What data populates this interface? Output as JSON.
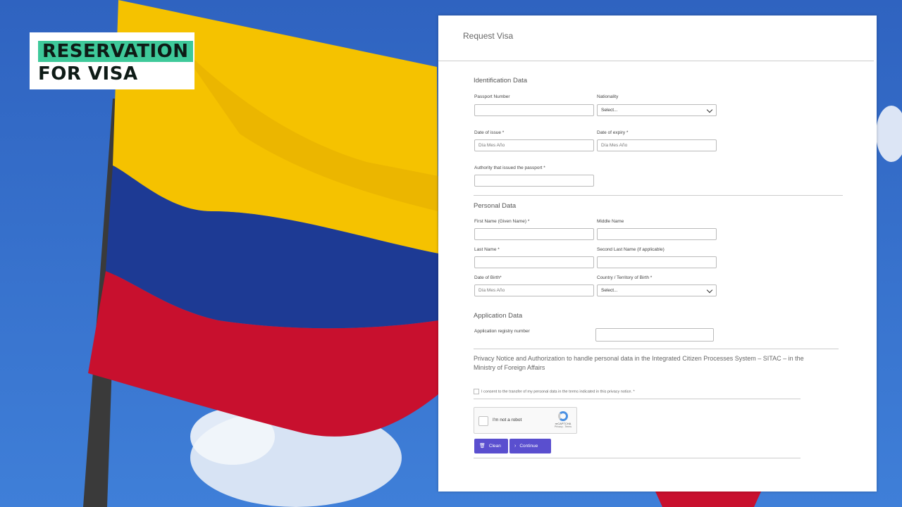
{
  "logo": {
    "line1": "RESERVATION",
    "line2": "FOR VISA"
  },
  "form": {
    "title": "Request Visa",
    "identification": {
      "heading": "Identification Data",
      "passport_number": {
        "label": "Passport Number",
        "value": ""
      },
      "nationality": {
        "label": "Nationality",
        "value": "Select..."
      },
      "date_of_issue": {
        "label": "Date of issue *",
        "placeholder": "Día Mes Año"
      },
      "date_of_expiry": {
        "label": "Date of expiry *",
        "placeholder": "Día Mes Año"
      },
      "authority": {
        "label": "Authority that issued the passport *",
        "value": ""
      }
    },
    "personal": {
      "heading": "Personal Data",
      "first_name": {
        "label": "First Name (Given Name) *"
      },
      "middle_name": {
        "label": "Middle Name"
      },
      "last_name": {
        "label": "Last Name *"
      },
      "second_last_name": {
        "label": "Second Last Name (if applicable)"
      },
      "date_of_birth": {
        "label": "Date of Birth*",
        "placeholder": "Día Mes Año"
      },
      "country_of_birth": {
        "label": "Country / Territory of Birth *",
        "value": "Select..."
      }
    },
    "application": {
      "heading": "Application Data",
      "registry": {
        "label": "Application registry number"
      }
    },
    "privacy_notice": "Privacy Notice and Authorization to handle personal data in the Integrated Citizen Processes System – SITAC – in the Ministry of Foreign Affairs",
    "consent_label": "I consent to the transfer of my personal data in the terms indicated in this privacy notice. *",
    "captcha": {
      "label": "I'm not a robot",
      "brand": "reCAPTCHA",
      "links": "Privacy - Terms"
    },
    "buttons": {
      "clean": "Clean",
      "continue": "Continue"
    }
  },
  "colors": {
    "button": "#5a4fcf",
    "logo_accent": "#3ec99a"
  },
  "icons": {
    "clean": "trash-icon",
    "continue": "chevron-right-icon",
    "select": "chevron-down-icon"
  }
}
